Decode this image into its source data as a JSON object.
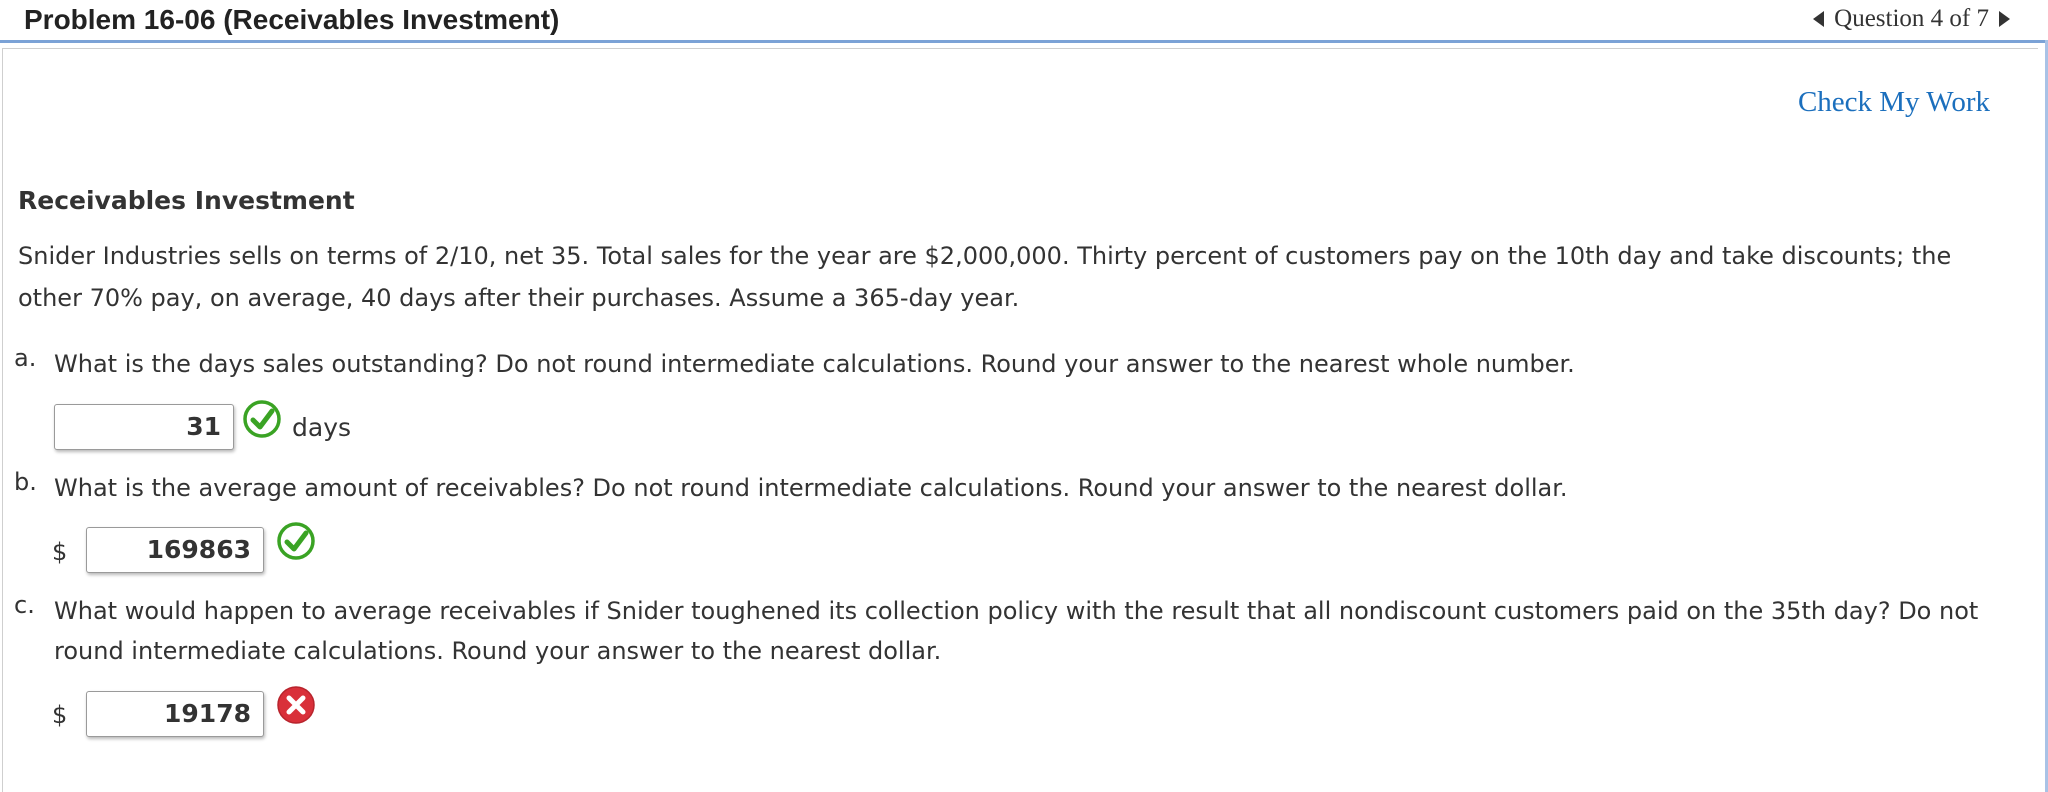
{
  "header": {
    "problem_title": "Problem 16-06 (Receivables Investment)",
    "question_nav": "Question 4 of 7"
  },
  "toolbar": {
    "check_my_work": "Check My Work"
  },
  "problem": {
    "section_title": "Receivables Investment",
    "intro": "Snider Industries sells on terms of 2/10, net 35. Total sales for the year are $2,000,000. Thirty percent of customers pay on the 10th day and take discounts; the other 70% pay, on average, 40 days after their purchases. Assume a 365-day year.",
    "questions": [
      {
        "letter": "a.",
        "text": "What is the days sales outstanding? Do not round intermediate calculations. Round your answer to the nearest whole number.",
        "answer": "31",
        "unit": "days",
        "status": "correct"
      },
      {
        "letter": "b.",
        "text": "What is the average amount of receivables? Do not round intermediate calculations. Round your answer to the nearest dollar.",
        "prefix": "$",
        "answer": "169863",
        "status": "correct"
      },
      {
        "letter": "c.",
        "text": "What would happen to average receivables if Snider toughened its collection policy with the result that all nondiscount customers paid on the 35th day? Do not round intermediate calculations. Round your answer to the nearest dollar.",
        "prefix": "$",
        "answer": "19178",
        "status": "incorrect"
      }
    ]
  },
  "colors": {
    "link": "#1b6fbd",
    "correct": "#3aa324",
    "incorrect": "#d9303a",
    "frame_blue": "#7ba2d6"
  },
  "icons": {
    "correct": "check-circle-icon",
    "incorrect": "x-circle-icon",
    "prev": "triangle-left-icon",
    "next": "triangle-right-icon"
  }
}
